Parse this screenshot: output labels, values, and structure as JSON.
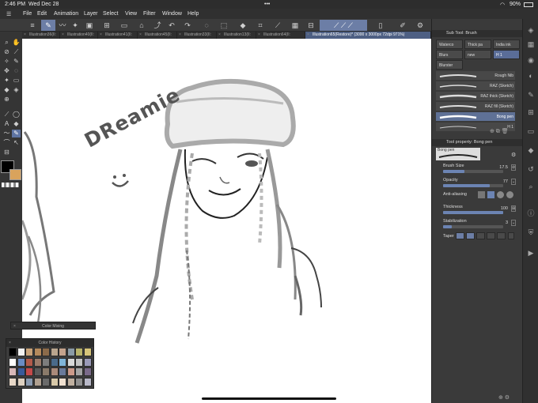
{
  "status": {
    "time": "2:46 PM",
    "date": "Wed Dec 28",
    "battery": "90%",
    "dots": "•••"
  },
  "menu": [
    "File",
    "Edit",
    "Animation",
    "Layer",
    "Select",
    "View",
    "Filter",
    "Window",
    "Help"
  ],
  "tabs": [
    "Illustration36(Il:",
    "Illustration40(Il:",
    "Illustration41(Il:",
    "Illustration45(Il:",
    "Illustration33(Il:",
    "Illustration13(Il:",
    "Illustration64(Il:",
    "Illustration65(Restore)* (3000 x 3000px 72dpi 971%)"
  ],
  "canvas_text": "DReamie",
  "sub_tool_panel": {
    "title": "Sub Tool: Brush",
    "subtabs": [
      "Waterco",
      "Thick pa",
      "India ink",
      "Blurs",
      "new",
      "H 1",
      "Blurster"
    ],
    "brushes": [
      "Rough Nib",
      "RAZ (Sketch)",
      "RAZ thick (Sketch)",
      "RAZ fill (Sketch)",
      "Bong pen",
      "H 1"
    ]
  },
  "tool_property": {
    "title": "Tool property: Bong pen",
    "brush_name": "Bong pen",
    "brush_size_label": "Brush Size",
    "brush_size_value": "17.5",
    "brush_size_fraction": 0.35,
    "opacity_label": "Opacity",
    "opacity_value": "77",
    "opacity_fraction": 0.77,
    "antialiasing_label": "Anti-aliasing",
    "thickness_label": "Thickness",
    "thickness_value": "100",
    "thickness_fraction": 1.0,
    "stabilization_label": "Stabilization",
    "stabilization_value": "3",
    "stabilization_fraction": 0.15,
    "taper_label": "Taper"
  },
  "color_mixing_title": "Color Mixing",
  "color_history": {
    "title": "Color History",
    "swatches": [
      "#000000",
      "#f2f2f2",
      "#c9a37a",
      "#b58a5c",
      "#8c6b4a",
      "#b9a58e",
      "#c4a38d",
      "#8a9aa6",
      "#b7b26b",
      "#d6c47a",
      "#ffffff",
      "#6a8cc4",
      "#b25a4a",
      "#9a7b6a",
      "#7d7d7d",
      "#4a6a8a",
      "#7fb4d8",
      "#d8d8d8",
      "#c4c4c4",
      "#9a9ab8",
      "#d8b8b8",
      "#3a5a9a",
      "#c44a4a",
      "#5a5a5a",
      "#8a7a6a",
      "#aa8a7a",
      "#6a7a9a",
      "#cc9a8a",
      "#a4a4a4",
      "#7a6a8a",
      "#e8d8c8",
      "#ddd0c0",
      "#8a9ab0",
      "#b0a090",
      "#6a6a6a",
      "#d8c8a8",
      "#f0e0d0",
      "#c0b0a0",
      "#909090",
      "#b8b8c8"
    ]
  },
  "colors": {
    "main": "#000000",
    "sub": "#d9a35c",
    "accent": "#6c7ea6"
  }
}
